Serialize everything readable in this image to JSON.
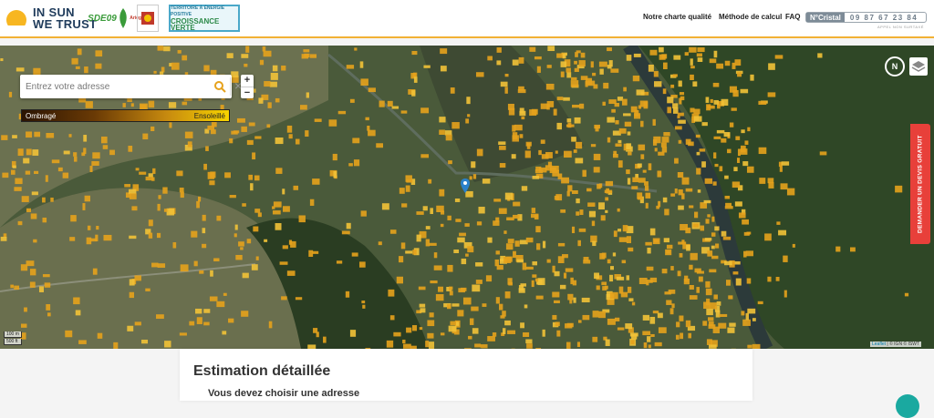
{
  "brand": {
    "line1": "IN SUN",
    "line2": "WE TRUST"
  },
  "partners": {
    "sde": "SDE09",
    "dept_text": "Ariège",
    "tepcv_line1": "TERRITOIRE À ÉNERGIE POSITIVE",
    "tepcv_big": "CROISSANCE VERTE"
  },
  "nav": {
    "charte": "Notre charte qualité",
    "methode": "Méthode de calcul",
    "faq": "FAQ"
  },
  "phone": {
    "label": "N°Cristal",
    "number": "09 87 67 23 84",
    "sub": "APPEL NON SURTAXÉ"
  },
  "search": {
    "placeholder": "Entrez votre adresse",
    "value": ""
  },
  "legend": {
    "left": "Ombragé",
    "right": "Ensoleillé"
  },
  "zoom": {
    "in": "+",
    "out": "−"
  },
  "compass": "N",
  "devis_label": "DEMANDER UN DEVIS GRATUIT",
  "scale": {
    "m": "100 m",
    "ft": "500 ft"
  },
  "attribution": {
    "leaflet": "Leaflet",
    "rest": " | © IGN © ISWT"
  },
  "card": {
    "title": "Estimation détaillée",
    "subtitle": "Vous devez choisir une adresse"
  },
  "icons": [
    "sun-logo-icon",
    "search-icon",
    "close-icon",
    "compass-icon",
    "layers-icon",
    "map-pin-icon",
    "help-icon"
  ],
  "colors": {
    "accent": "#f2b134",
    "devis": "#e8403a",
    "roof": "#e6a21c",
    "help": "#1aa9a0"
  }
}
